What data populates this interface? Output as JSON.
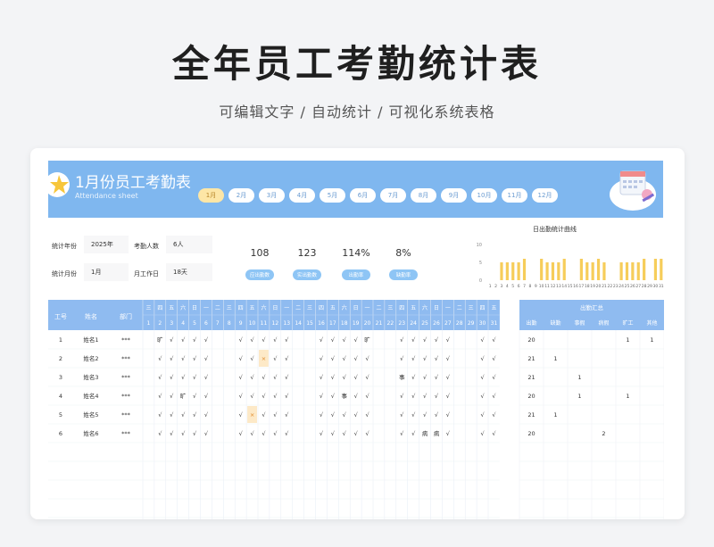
{
  "hero": {
    "title": "全年员工考勤统计表",
    "subtitle": "可编辑文字 / 自动统计 / 可视化系统表格"
  },
  "sheet": {
    "title": "1月份员工考勤表",
    "subtitle": "Attendance sheet",
    "months": [
      "1月",
      "2月",
      "3月",
      "4月",
      "5月",
      "6月",
      "7月",
      "8月",
      "9月",
      "10月",
      "11月",
      "12月"
    ],
    "active_month": 0
  },
  "info": {
    "year_label": "统计年份",
    "year_value": "2025年",
    "month_label": "统计月份",
    "month_value": "1月",
    "headcount_label": "考勤人数",
    "headcount_value": "6人",
    "workdays_label": "月工作日",
    "workdays_value": "18天"
  },
  "kpis": [
    {
      "value": "108",
      "label": "应出勤数"
    },
    {
      "value": "123",
      "label": "实出勤数"
    },
    {
      "value": "114%",
      "label": "出勤率"
    },
    {
      "value": "8%",
      "label": "缺勤率"
    }
  ],
  "chart_data": {
    "type": "bar",
    "title": "日出勤统计曲线",
    "categories": [
      "1",
      "2",
      "3",
      "4",
      "5",
      "6",
      "7",
      "8",
      "9",
      "10",
      "11",
      "12",
      "13",
      "14",
      "15",
      "16",
      "17",
      "18",
      "19",
      "20",
      "21",
      "22",
      "23",
      "24",
      "25",
      "26",
      "27",
      "28",
      "29",
      "30",
      "31"
    ],
    "values": [
      0,
      0,
      5,
      5,
      5,
      5,
      6,
      0,
      0,
      6,
      5,
      5,
      5,
      6,
      0,
      0,
      6,
      5,
      5,
      6,
      5,
      0,
      0,
      5,
      5,
      5,
      5,
      6,
      0,
      6,
      6
    ],
    "ylim": [
      0,
      10
    ],
    "yticks": [
      "0",
      "5",
      "10"
    ],
    "color": "#f6cd5a"
  },
  "table": {
    "headers": {
      "id": "工号",
      "name": "姓名",
      "dept": "部门"
    },
    "weekdays": [
      "三",
      "四",
      "五",
      "六",
      "日",
      "一",
      "二",
      "三",
      "四",
      "五",
      "六",
      "日",
      "一",
      "二",
      "三",
      "四",
      "五",
      "六",
      "日",
      "一",
      "二",
      "三",
      "四",
      "五",
      "六",
      "日",
      "一",
      "二",
      "三",
      "四",
      "五"
    ],
    "days": [
      "1",
      "2",
      "3",
      "4",
      "5",
      "6",
      "7",
      "8",
      "9",
      "10",
      "11",
      "12",
      "13",
      "14",
      "15",
      "16",
      "17",
      "18",
      "19",
      "20",
      "21",
      "22",
      "23",
      "24",
      "25",
      "26",
      "27",
      "28",
      "29",
      "30",
      "31"
    ],
    "rows": [
      {
        "id": "1",
        "name": "姓名1",
        "dept": "***",
        "marks": [
          "",
          "旷",
          "√",
          "√",
          "√",
          "√",
          "",
          "",
          "√",
          "√",
          "√",
          "√",
          "√",
          "",
          "",
          "√",
          "√",
          "√",
          "√",
          "旷",
          "",
          "",
          "√",
          "√",
          "√",
          "√",
          "√",
          "",
          "",
          "√",
          "√"
        ]
      },
      {
        "id": "2",
        "name": "姓名2",
        "dept": "***",
        "marks": [
          "",
          "√",
          "√",
          "√",
          "√",
          "√",
          "",
          "",
          "√",
          "√",
          "×",
          "√",
          "√",
          "",
          "",
          "√",
          "√",
          "√",
          "√",
          "√",
          "",
          "",
          "√",
          "√",
          "√",
          "√",
          "√",
          "",
          "",
          "√",
          "√"
        ]
      },
      {
        "id": "3",
        "name": "姓名3",
        "dept": "***",
        "marks": [
          "",
          "√",
          "√",
          "√",
          "√",
          "√",
          "",
          "",
          "√",
          "√",
          "√",
          "√",
          "√",
          "",
          "",
          "√",
          "√",
          "√",
          "√",
          "√",
          "",
          "",
          "事",
          "√",
          "√",
          "√",
          "√",
          "",
          "",
          "√",
          "√"
        ]
      },
      {
        "id": "4",
        "name": "姓名4",
        "dept": "***",
        "marks": [
          "",
          "√",
          "√",
          "旷",
          "√",
          "√",
          "",
          "",
          "√",
          "√",
          "√",
          "√",
          "√",
          "",
          "",
          "√",
          "√",
          "事",
          "√",
          "√",
          "",
          "",
          "√",
          "√",
          "√",
          "√",
          "√",
          "",
          "",
          "√",
          "√"
        ]
      },
      {
        "id": "5",
        "name": "姓名5",
        "dept": "***",
        "marks": [
          "",
          "√",
          "√",
          "√",
          "√",
          "√",
          "",
          "",
          "√",
          "×",
          "√",
          "√",
          "√",
          "",
          "",
          "√",
          "√",
          "√",
          "√",
          "√",
          "",
          "",
          "√",
          "√",
          "√",
          "√",
          "√",
          "",
          "",
          "√",
          "√"
        ]
      },
      {
        "id": "6",
        "name": "姓名6",
        "dept": "***",
        "marks": [
          "",
          "√",
          "√",
          "√",
          "√",
          "√",
          "",
          "",
          "√",
          "√",
          "√",
          "√",
          "√",
          "",
          "",
          "√",
          "√",
          "√",
          "√",
          "√",
          "",
          "",
          "√",
          "√",
          "病",
          "病",
          "√",
          "",
          "",
          "√",
          "√"
        ]
      }
    ],
    "summary_title": "出勤汇总",
    "summary_headers": [
      "出勤",
      "缺勤",
      "事假",
      "病假",
      "旷工",
      "其他"
    ],
    "summary_rows": [
      [
        "20",
        "",
        "",
        "",
        "1",
        "1"
      ],
      [
        "21",
        "1",
        "",
        "",
        "",
        ""
      ],
      [
        "21",
        "",
        "1",
        "",
        "",
        ""
      ],
      [
        "20",
        "",
        "1",
        "",
        "1",
        ""
      ],
      [
        "21",
        "1",
        "",
        "",
        "",
        ""
      ],
      [
        "20",
        "",
        "",
        "2",
        "",
        ""
      ]
    ]
  }
}
